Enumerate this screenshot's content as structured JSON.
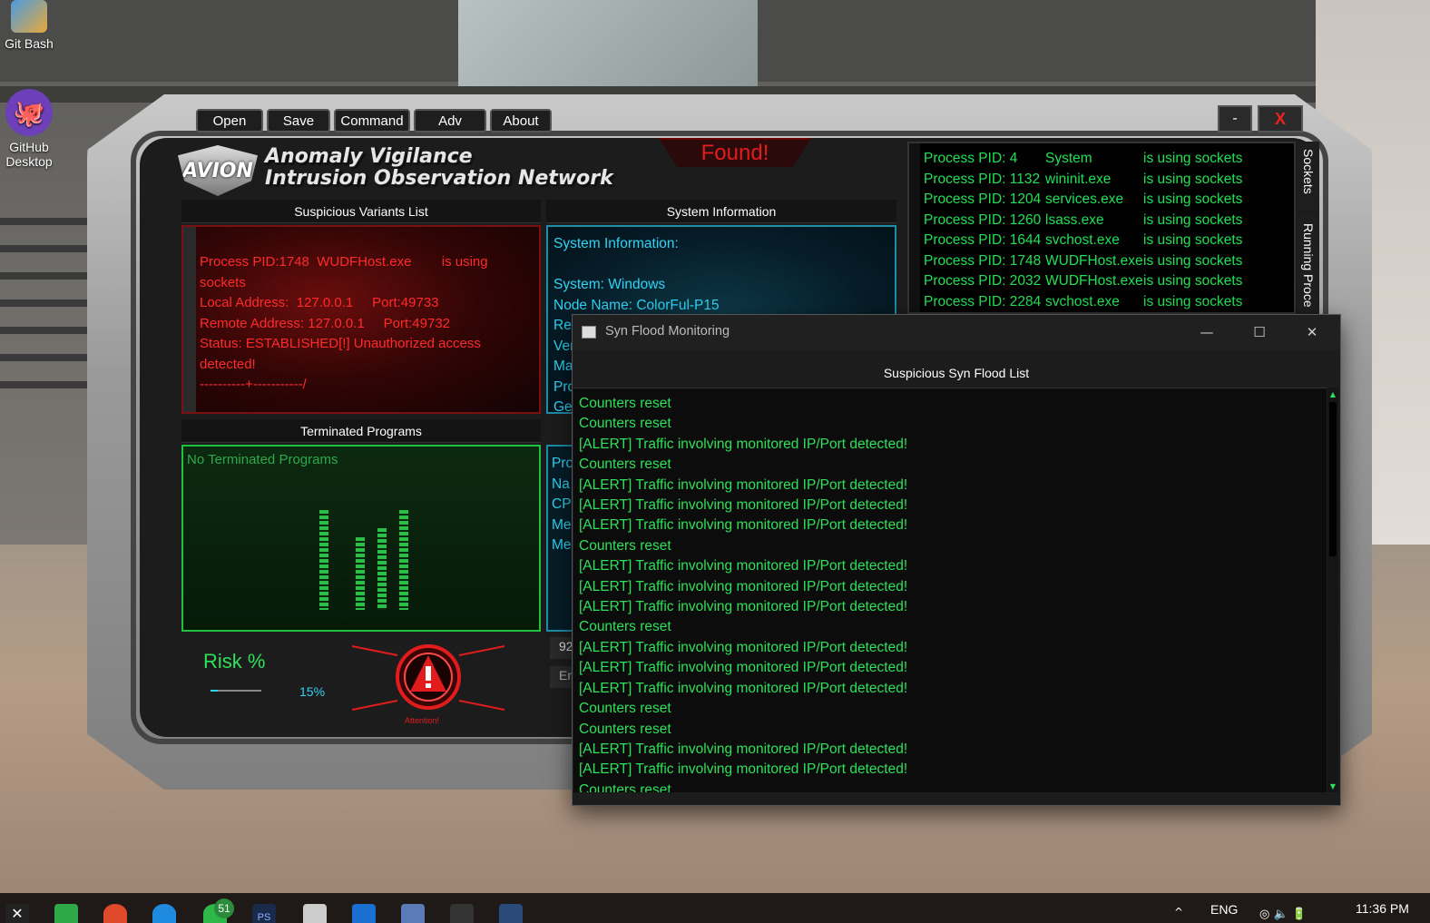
{
  "desktop": {
    "icons": [
      {
        "label": "Git Bash"
      },
      {
        "label": "GitHub Desktop"
      }
    ]
  },
  "avion": {
    "menu": {
      "open": "Open",
      "save": "Save",
      "command": "Command",
      "adv": "Adv",
      "about": "About"
    },
    "window_controls": {
      "minimize": "-",
      "close": "X"
    },
    "logo": {
      "badge": "AVION",
      "line1": "Anomaly Vigilance",
      "line2": "Intrusion Observation Network"
    },
    "status": "Found!",
    "panels": {
      "variants_title": "Suspicious Variants List",
      "sysinfo_title": "System Information",
      "terminated_title": "Terminated Programs"
    },
    "variants_text": "Process PID:1748  WUDFHost.exe        is using sockets\nLocal Address:  127.0.0.1     Port:49733\nRemote Address: 127.0.0.1     Port:49732\nStatus: ESTABLISHED[!] Unauthorized access detected!\n----------+-----------/",
    "sysinfo_text": "System Information:\n\nSystem: Windows\nNode Name: ColorFul-P15\nRel\nVer\nMa\nPro\nGe",
    "terminated_text": "No Terminated Programs",
    "sysinfo2_text": "Pro\nNa\nCPU\nMe\nMe",
    "risk": {
      "label": "Risk %",
      "value": "15%",
      "fraction": 0.15
    },
    "attention": "Attention!",
    "partial_field1": "92",
    "partial_field2": "En",
    "sockets": [
      {
        "pid": "Process PID: 4",
        "name": "System",
        "msg": "is using sockets"
      },
      {
        "pid": "Process PID: 1132",
        "name": "wininit.exe",
        "msg": "is using sockets"
      },
      {
        "pid": "Process PID: 1204",
        "name": "services.exe",
        "msg": "is using sockets"
      },
      {
        "pid": "Process PID: 1260",
        "name": "lsass.exe",
        "msg": "is using sockets"
      },
      {
        "pid": "Process PID: 1644",
        "name": "svchost.exe",
        "msg": "is using sockets"
      },
      {
        "pid": "Process PID: 1748",
        "name": "WUDFHost.exe",
        "msg": "is using sockets"
      },
      {
        "pid": "Process PID: 2032",
        "name": "WUDFHost.exe",
        "msg": "is using sockets"
      },
      {
        "pid": "Process PID: 2284",
        "name": "svchost.exe",
        "msg": "is using sockets"
      }
    ],
    "side_tabs": {
      "sockets": "Sockets",
      "running": "Running Proce"
    }
  },
  "synflood": {
    "title": "Syn Flood Monitoring",
    "list_title": "Suspicious Syn Flood List",
    "controls": {
      "minimize": "—",
      "maximize": "☐",
      "close": "✕"
    },
    "items": [
      "Counters reset",
      "Counters reset",
      "[ALERT] Traffic involving monitored IP/Port detected!",
      "Counters reset",
      "[ALERT] Traffic involving monitored IP/Port detected!",
      "[ALERT] Traffic involving monitored IP/Port detected!",
      "[ALERT] Traffic involving monitored IP/Port detected!",
      "Counters reset",
      "[ALERT] Traffic involving monitored IP/Port detected!",
      "[ALERT] Traffic involving monitored IP/Port detected!",
      "[ALERT] Traffic involving monitored IP/Port detected!",
      "Counters reset",
      "[ALERT] Traffic involving monitored IP/Port detected!",
      "[ALERT] Traffic involving monitored IP/Port detected!",
      "[ALERT] Traffic involving monitored IP/Port detected!",
      "Counters reset",
      "Counters reset",
      "[ALERT] Traffic involving monitored IP/Port detected!",
      "[ALERT] Traffic involving monitored IP/Port detected!",
      "Counters reset"
    ]
  },
  "taskbar": {
    "badge": "51",
    "ps_label": "PS",
    "language": "ENG",
    "time": "11:36 PM"
  },
  "colors": {
    "alert_red": "#ff2b2b",
    "info_cyan": "#2fd4f4",
    "ok_green": "#2fe05a"
  }
}
